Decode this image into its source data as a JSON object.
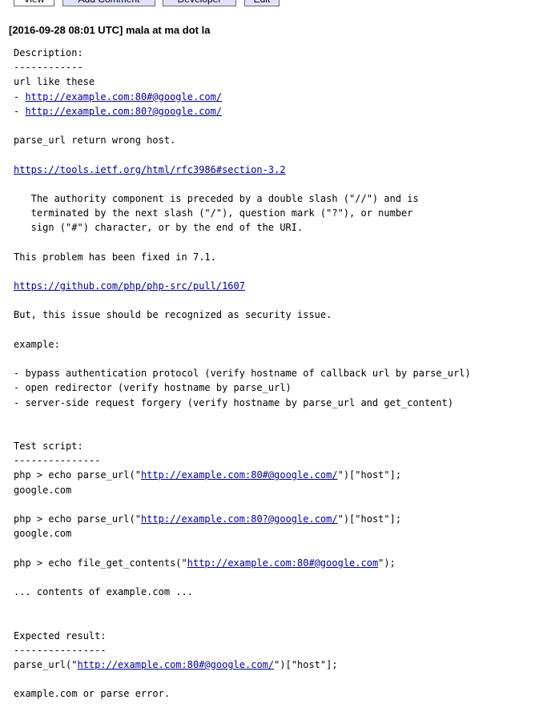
{
  "tabs": {
    "view": "View",
    "add_comment": "Add Comment",
    "developer": "Developer",
    "edit": "Edit"
  },
  "comment": {
    "header": "[2016-09-28 08:01 UTC] mala at ma dot la",
    "lines": {
      "l01": "Description:",
      "l02": "------------",
      "l03": "url like these",
      "l04_pre": "- ",
      "l04_link": "http://example.com:80#@google.com/",
      "l05_pre": "- ",
      "l05_link": "http://example.com:80?@google.com/",
      "l07": "parse_url return wrong host.",
      "l09_link": "https://tools.ietf.org/html/rfc3986#section-3.2",
      "l11": "   The authority component is preceded by a double slash (\"//\") and is",
      "l12": "   terminated by the next slash (\"/\"), question mark (\"?\"), or number",
      "l13": "   sign (\"#\") character, or by the end of the URI.",
      "l15": "This problem has been fixed in 7.1.",
      "l17_link": "https://github.com/php/php-src/pull/1607",
      "l19": "But, this issue should be recognized as security issue.",
      "l21": "example:",
      "l23": "- bypass authentication protocol (verify hostname of callback url by parse_url)",
      "l24": "- open redirector (verify hostname by parse_url)",
      "l25": "- server-side request forgery (verify hostname by parse_url and get_content)",
      "l28": "Test script:",
      "l29": "---------------",
      "l30_pre": "php > echo parse_url(\"",
      "l30_link": "http://example.com:80#@google.com/",
      "l30_post": "\")[\"host\"];",
      "l31": "google.com",
      "l33_pre": "php > echo parse_url(\"",
      "l33_link": "http://example.com:80?@google.com/",
      "l33_post": "\")[\"host\"];",
      "l34": "google.com",
      "l36_pre": "php > echo file_get_contents(\"",
      "l36_link": "http://example.com:80#@google.com",
      "l36_post": "\");",
      "l38": "... contents of example.com ...",
      "l41": "Expected result:",
      "l42": "----------------",
      "l43_pre": "parse_url(\"",
      "l43_link": "http://example.com:80#@google.com/",
      "l43_post": "\")[\"host\"];",
      "l45": "example.com or parse error."
    }
  },
  "colors": {
    "link": "#000099",
    "tab_bg": "#e0e0ff"
  }
}
